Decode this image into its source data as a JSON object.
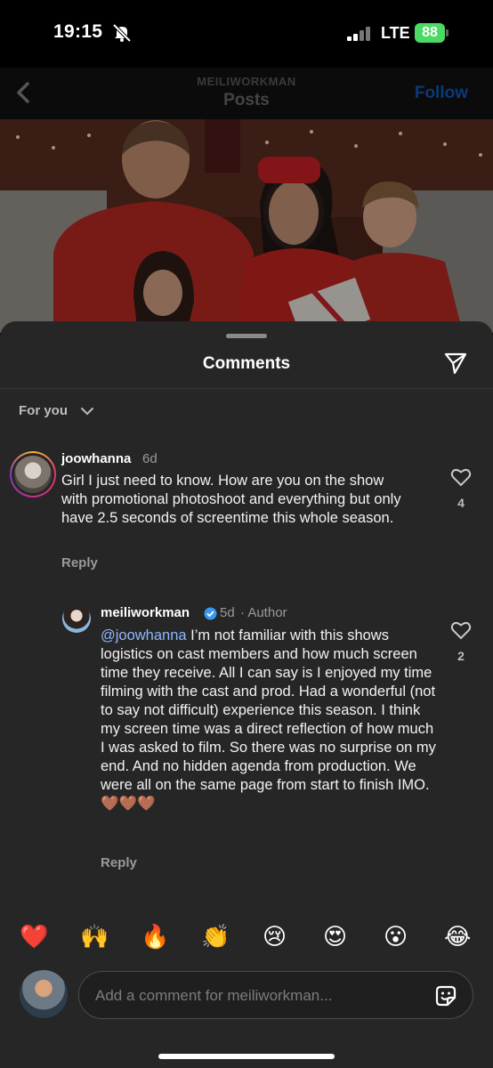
{
  "status_bar": {
    "time": "19:15",
    "network": "LTE",
    "battery": "88"
  },
  "header": {
    "account": "MEILIWORKMAN",
    "title": "Posts",
    "follow_label": "Follow"
  },
  "sheet": {
    "title": "Comments",
    "filter_label": "For you"
  },
  "comments": [
    {
      "username": "joowhanna",
      "age": "6d",
      "text": "Girl I just need to know. How are you on the show with promotional photoshoot and everything but only have 2.5 seconds of screentime this whole season.",
      "reply_label": "Reply",
      "likes": "4"
    }
  ],
  "reply": {
    "username": "meiliworkman",
    "age": "5d",
    "author_tag": "· Author",
    "mention": "@joowhanna",
    "text": " I’m not familiar with this shows logistics on cast members and how much screen time they receive. All I can say is I enjoyed my time filming with the cast and prod. Had a wonderful (not to say not difficult) experience this season. I think my screen time was a direct reflection of how much I was asked to film. So there was no surprise on my end. And no hidden agenda from production. We were all on the same page from start to finish IMO. 🤎🤎🤎",
    "reply_label": "Reply",
    "likes": "2"
  },
  "quick_reactions": [
    "❤️",
    "🙌",
    "🔥",
    "👏",
    "😢",
    "😍",
    "😮",
    "😂"
  ],
  "composer": {
    "placeholder": "Add a comment for meiliworkman..."
  },
  "icons": [
    "bell-slash-icon",
    "back-chevron-icon",
    "send-icon",
    "chevron-down-icon",
    "heart-icon",
    "verified-icon",
    "sticker-icon"
  ]
}
